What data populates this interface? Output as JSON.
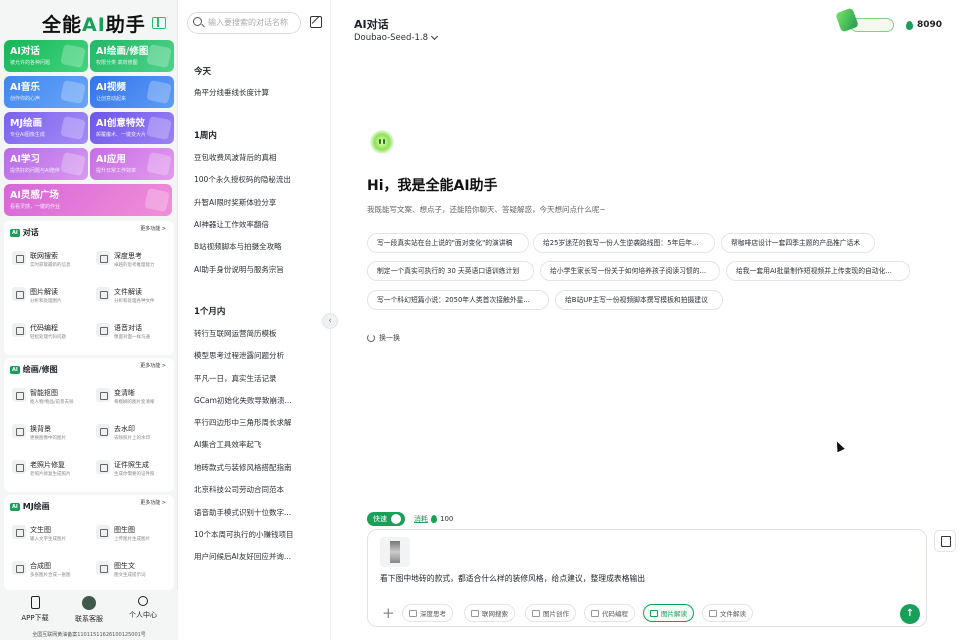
{
  "brand": {
    "logo_prefix": "全能",
    "logo_ai": "AI",
    "logo_suffix": "助手"
  },
  "tiles": [
    {
      "title": "AI对话",
      "sub": "被允许的各种问题",
      "color": "#1fbf5f"
    },
    {
      "title": "AI绘画/修图",
      "sub": "权限分类 高效修图",
      "color": "#27c26c"
    },
    {
      "title": "AI音乐",
      "sub": "创作你的心声",
      "color": "#4e8ff2"
    },
    {
      "title": "AI视频",
      "sub": "让创意动起来",
      "color": "#3d7ef0"
    },
    {
      "title": "MJ绘画",
      "sub": "专业AI图像生成",
      "color": "#8a6df2"
    },
    {
      "title": "AI创意特效",
      "sub": "颠覆魔术、一键变大片",
      "color": "#7b5ff0"
    },
    {
      "title": "AI学习",
      "sub": "提供好的问题与AI陪伴",
      "color": "#c67ae8"
    },
    {
      "title": "AI应用",
      "sub": "提升日常工作效率",
      "color": "#d57ee6"
    },
    {
      "title": "AI灵感广场",
      "sub": "看看灵感，一键的作业",
      "color": "#e06fd4"
    }
  ],
  "sections": [
    {
      "badge": "AI",
      "title": "对话",
      "more": "更多功能 >",
      "items": [
        {
          "name": "联网搜索",
          "desc": "实时获取最新的信息"
        },
        {
          "name": "深度思考",
          "desc": "卓越的思考推理能力"
        },
        {
          "name": "图片解读",
          "desc": "分析和处理图片"
        },
        {
          "name": "文件解读",
          "desc": "分析和处理各种文件"
        },
        {
          "name": "代码编程",
          "desc": "轻松处理代码问题"
        },
        {
          "name": "语音对话",
          "desc": "像面对面一样沟通"
        }
      ]
    },
    {
      "badge": "AI",
      "title": "绘画/修图",
      "more": "更多功能 >",
      "items": [
        {
          "name": "智能抠图",
          "desc": "抠人物/物品/前景去除"
        },
        {
          "name": "变清晰",
          "desc": "将模糊的图片变清晰"
        },
        {
          "name": "换背景",
          "desc": "更换图像中的图片"
        },
        {
          "name": "去水印",
          "desc": "去除照片上的水印"
        },
        {
          "name": "老照片修复",
          "desc": "老照片修复生成照片"
        },
        {
          "name": "证件照生成",
          "desc": "生成你需要的证件照"
        }
      ]
    },
    {
      "badge": "AI",
      "title": "MJ绘画",
      "more": "更多功能 >",
      "items": [
        {
          "name": "文生图",
          "desc": "输入文字生成图片"
        },
        {
          "name": "图生图",
          "desc": "上传图片生成图片"
        },
        {
          "name": "合成图",
          "desc": "多张图片合成一张图"
        },
        {
          "name": "图生文",
          "desc": "图文生成提示词"
        }
      ]
    }
  ],
  "bottom": {
    "app": "APP下载",
    "service": "联系客服",
    "profile": "个人中心",
    "icp": "全国互联网黄油备案11011511626100125001号"
  },
  "search": {
    "placeholder": "输入要搜索的对话名称"
  },
  "history": {
    "today_label": "今天",
    "today": [
      "角平分线垂线长度计算"
    ],
    "week_label": "1周内",
    "week": [
      "豆包收费风波背后的真相",
      "100个永久授权码的隐秘流出",
      "升智AI限时奖斯体验分享",
      "AI神器让工作效率翻倍",
      "B站视频脚本与拍摄全攻略",
      "AI助手身份说明与服务宗旨"
    ],
    "month_label": "1个月内",
    "month": [
      "转行互联网运营简历模板",
      "模型思考过程泄露问题分析",
      "平凡一日，真实生活记录",
      "GCam初始化失败导致崩溃...",
      "平行四边形中三角形周长求解",
      "AI集合工具效率起飞",
      "地砖款式与装修风格搭配指南",
      "北京科技公司劳动合同范本",
      "语音助手模式识别十位数字...",
      "10个本周可执行的小赚钱项目",
      "用户问候后AI友好回应并询..."
    ]
  },
  "main": {
    "title": "AI对话",
    "model": "Doubao-Seed-1.8",
    "credits": "8090",
    "greeting": "Hi，我是全能AI助手",
    "greeting_sub": "我既能写文案、想点子，还能陪你聊天、答疑解惑，今天想问点什么呢~",
    "suggestions": [
      [
        "写一段真实站在台上说的\"面对变化\"的演讲稿",
        "给25岁迷茫的我写一份人生逆袭路线图：5年后年...",
        "帮咖啡店设计一套四季主题的产品推广话术"
      ],
      [
        "制定一个真实可执行的 30 天英语口语训练计划",
        "给小学生家长写一份关于如何培养孩子阅读习惯的...",
        "给我一套用AI批量制作短视频并上传变现的自动化..."
      ],
      [
        "写一个科幻短篇小说：2050年人类首次接触外星...",
        "给B站UP主写一份视频脚本撰写模板和拍摄建议"
      ]
    ],
    "refresh": "换一换",
    "fast_label": "快速",
    "cost_label": "消耗",
    "cost_value": "100",
    "prompt": "看下图中地砖的款式，都适合什么样的装修风格，给点建议，整理成表格输出",
    "tools": [
      "深度思考",
      "联网搜索",
      "图片创作",
      "代码编程",
      "图片解读",
      "文件解读"
    ],
    "active_tool": "图片解读",
    "accent": "#18a058"
  }
}
